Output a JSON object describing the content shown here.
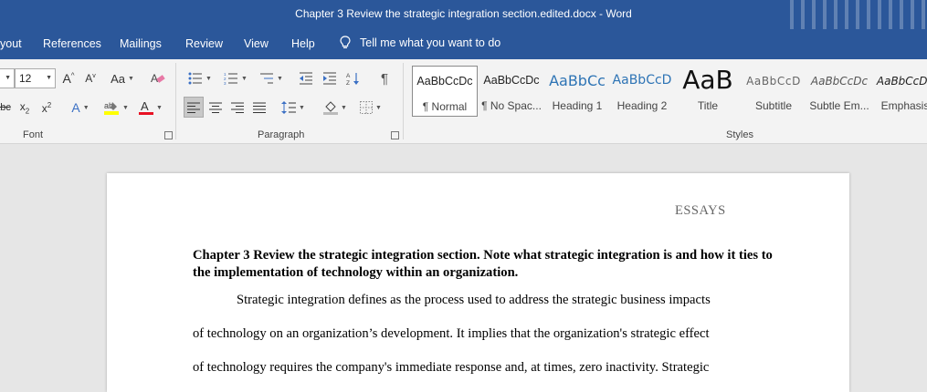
{
  "window": {
    "title": "Chapter 3 Review the strategic integration section.edited.docx  -  Word"
  },
  "tabs": [
    "yout",
    "References",
    "Mailings",
    "Review",
    "View",
    "Help"
  ],
  "tell_me": "Tell me what you want to do",
  "font_group": {
    "font_size": "12",
    "label": "Font"
  },
  "paragraph_group": {
    "label": "Paragraph"
  },
  "styles_group": {
    "label": "Styles",
    "items": [
      {
        "preview": "AaBbCcDc",
        "name": "¶ Normal"
      },
      {
        "preview": "AaBbCcDc",
        "name": "¶ No Spac..."
      },
      {
        "preview": "AaBbCc",
        "name": "Heading 1"
      },
      {
        "preview": "AaBbCcD",
        "name": "Heading 2"
      },
      {
        "preview": "AaB",
        "name": "Title"
      },
      {
        "preview": "AaBbCcD",
        "name": "Subtitle"
      },
      {
        "preview": "AaBbCcDc",
        "name": "Subtle Em..."
      },
      {
        "preview": "AaBbCcDc",
        "name": "Emphasis"
      }
    ]
  },
  "document": {
    "header": "ESSAYS",
    "heading": "Chapter 3 Review the strategic integration section. Note what strategic integration is and how it ties to the implementation of technology within an organization.",
    "lines": [
      "Strategic integration defines as the process used to address the strategic business impacts",
      "of technology on an organization’s development. It implies that the organization's strategic effect",
      "of technology requires the company's immediate response and, at times, zero inactivity. Strategic"
    ]
  },
  "colors": {
    "title_bar": "#2b579a",
    "ribbon": "#f3f3f3",
    "workspace": "#e6e6e6",
    "font_color_accent": "#e81123",
    "highlight_accent": "#ffff00"
  }
}
